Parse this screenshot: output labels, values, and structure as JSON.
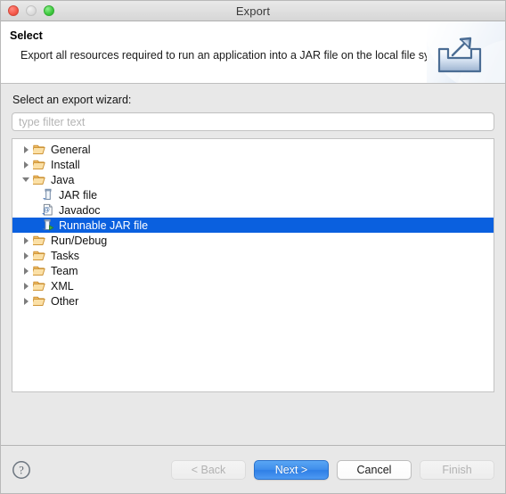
{
  "window": {
    "title": "Export",
    "traffic_lights": [
      "close-button",
      "minimize-button",
      "zoom-button"
    ]
  },
  "header": {
    "title": "Select",
    "description": "Export all resources required to run an application into a JAR file on the local file system.",
    "banner_icon": "export-tray-arrow-icon"
  },
  "main": {
    "wizard_label": "Select an export wizard:",
    "filter": {
      "placeholder": "type filter text",
      "value": ""
    },
    "tree": [
      {
        "label": "General",
        "level": 0,
        "icon": "folder-icon",
        "state": "collapsed",
        "selected": false
      },
      {
        "label": "Install",
        "level": 0,
        "icon": "folder-icon",
        "state": "collapsed",
        "selected": false
      },
      {
        "label": "Java",
        "level": 0,
        "icon": "folder-icon",
        "state": "expanded",
        "selected": false
      },
      {
        "label": "JAR file",
        "level": 1,
        "icon": "jar-file-icon",
        "state": "leaf",
        "selected": false
      },
      {
        "label": "Javadoc",
        "level": 1,
        "icon": "javadoc-icon",
        "state": "leaf",
        "selected": false
      },
      {
        "label": "Runnable JAR file",
        "level": 1,
        "icon": "runnable-jar-icon",
        "state": "leaf",
        "selected": true
      },
      {
        "label": "Run/Debug",
        "level": 0,
        "icon": "folder-icon",
        "state": "collapsed",
        "selected": false
      },
      {
        "label": "Tasks",
        "level": 0,
        "icon": "folder-icon",
        "state": "collapsed",
        "selected": false
      },
      {
        "label": "Team",
        "level": 0,
        "icon": "folder-icon",
        "state": "collapsed",
        "selected": false
      },
      {
        "label": "XML",
        "level": 0,
        "icon": "folder-icon",
        "state": "collapsed",
        "selected": false
      },
      {
        "label": "Other",
        "level": 0,
        "icon": "folder-icon",
        "state": "collapsed",
        "selected": false
      }
    ]
  },
  "footer": {
    "help_icon": "help-question-icon",
    "buttons": [
      {
        "label": "< Back",
        "state": "disabled",
        "style": "default"
      },
      {
        "label": "Next >",
        "state": "enabled",
        "style": "primary"
      },
      {
        "label": "Cancel",
        "state": "enabled",
        "style": "white"
      },
      {
        "label": "Finish",
        "state": "disabled",
        "style": "default"
      }
    ]
  },
  "colors": {
    "selection_blue": "#0a60df",
    "primary_button": "#3f8eeb",
    "dialog_background": "#e8e8e8",
    "folder_icon": "#e8a33d"
  }
}
